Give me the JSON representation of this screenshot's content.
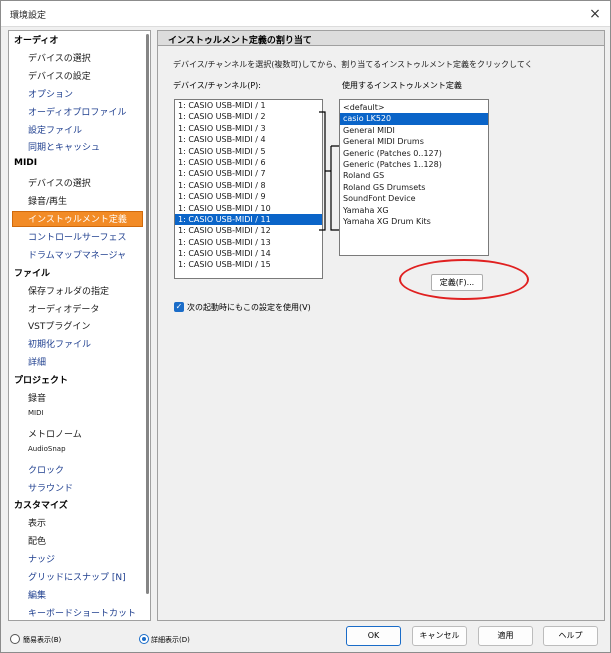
{
  "window": {
    "title": "環境設定",
    "close_glyph": "×"
  },
  "sidebar": {
    "categories": [
      {
        "label": "オーディオ",
        "items": [
          {
            "label": "デバイスの選択"
          },
          {
            "label": "デバイスの設定"
          },
          {
            "label": "オプション"
          },
          {
            "label": "オーディオプロファイル"
          },
          {
            "label": "設定ファイル"
          },
          {
            "label": "同期とキャッシュ"
          }
        ]
      },
      {
        "label": "MIDI",
        "items": [
          {
            "label": "デバイスの選択"
          },
          {
            "label": "録音/再生"
          },
          {
            "label": "インストゥルメント定義"
          },
          {
            "label": "コントロールサーフェス"
          },
          {
            "label": "ドラムマップマネージャ"
          }
        ]
      },
      {
        "label": "ファイル",
        "items": [
          {
            "label": "保存フォルダの指定"
          },
          {
            "label": "オーディオデータ"
          },
          {
            "label": "VSTプラグイン"
          },
          {
            "label": "初期化ファイル"
          },
          {
            "label": "詳細"
          }
        ]
      },
      {
        "label": "プロジェクト",
        "items": [
          {
            "label": "録音"
          },
          {
            "label": "MIDI"
          },
          {
            "label": "メトロノーム"
          },
          {
            "label": "AudioSnap"
          },
          {
            "label": "クロック"
          },
          {
            "label": "サラウンド"
          }
        ]
      },
      {
        "label": "カスタマイズ",
        "items": [
          {
            "label": "表示"
          },
          {
            "label": "配色"
          },
          {
            "label": "ナッジ"
          },
          {
            "label": "グリッドにスナップ [N]"
          },
          {
            "label": "編集"
          },
          {
            "label": "キーボードショートカット"
          }
        ]
      }
    ]
  },
  "main": {
    "section_title": "インストゥルメント定義の割り当て",
    "instruction": "デバイス/チャンネルを選択(複数可)してから、割り当てるインストゥルメント定義をクリックしてく",
    "device_label": "デバイス/チャンネル(P):",
    "instrument_label": "使用するインストゥルメント定義",
    "channels": [
      "1: CASIO USB-MIDI / 1",
      "1: CASIO USB-MIDI / 2",
      "1: CASIO USB-MIDI / 3",
      "1: CASIO USB-MIDI / 4",
      "1: CASIO USB-MIDI / 5",
      "1: CASIO USB-MIDI / 6",
      "1: CASIO USB-MIDI / 7",
      "1: CASIO USB-MIDI / 8",
      "1: CASIO USB-MIDI / 9",
      "1: CASIO USB-MIDI / 10",
      "1: CASIO USB-MIDI / 11",
      "1: CASIO USB-MIDI / 12",
      "1: CASIO USB-MIDI / 13",
      "1: CASIO USB-MIDI / 14",
      "1: CASIO USB-MIDI / 15"
    ],
    "selected_channel": 10,
    "instruments": [
      "<default>",
      "casio LK520",
      "General MIDI",
      "General MIDI Drums",
      "Generic (Patches 0..127)",
      "Generic (Patches 1..128)",
      "Roland GS",
      "Roland GS Drumsets",
      "SoundFont Device",
      "Yamaha XG",
      "Yamaha XG Drum Kits"
    ],
    "selected_instrument": 1,
    "define_button": "定義(F)...",
    "checkbox_label": "次の起動時にもこの設定を使用(V)",
    "checkbox_mark": "✓"
  },
  "footer": {
    "simple_view": "簡易表示(B)",
    "detail_view": "詳細表示(D)",
    "ok": "OK",
    "cancel": "キャンセル",
    "apply": "適用",
    "help": "ヘルプ"
  },
  "colors": {
    "selection_orange": "#f28b26",
    "selection_blue": "#0a64c8",
    "annotation_red": "#e02020"
  }
}
